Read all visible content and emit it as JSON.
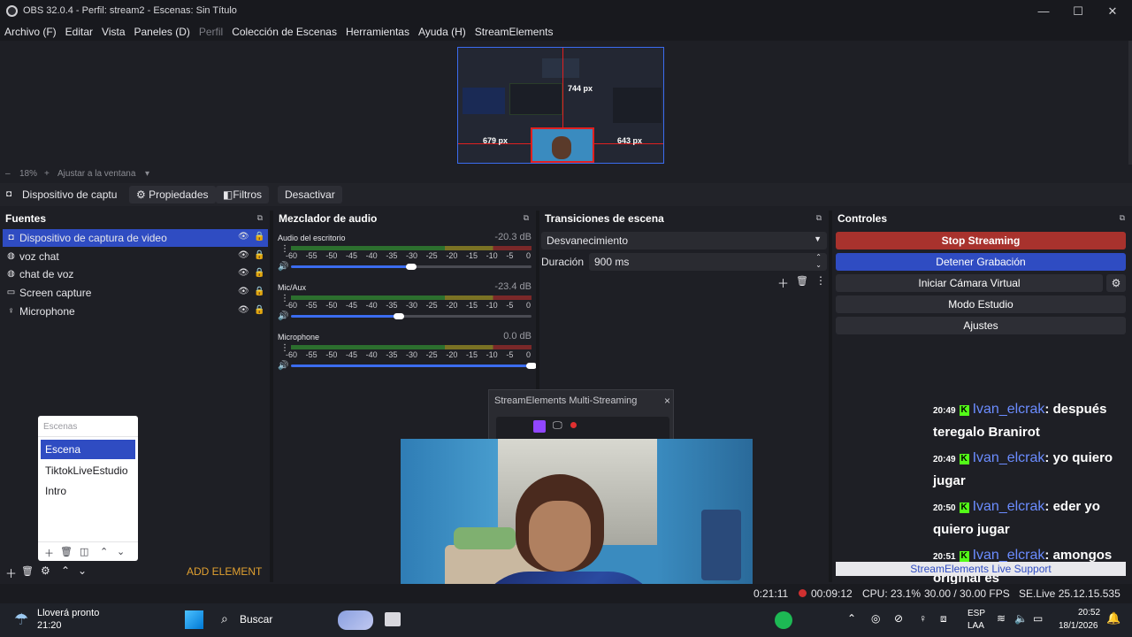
{
  "window": {
    "title": "OBS 32.0.4 - Perfil: stream2 - Escenas: Sin Título",
    "minimize": "—",
    "maximize": "☐",
    "close": "✕"
  },
  "menu": [
    {
      "label": "Archivo (F)",
      "dim": false
    },
    {
      "label": "Editar",
      "dim": false
    },
    {
      "label": "Vista",
      "dim": false
    },
    {
      "label": "Paneles (D)",
      "dim": false
    },
    {
      "label": "Perfil",
      "dim": true
    },
    {
      "label": "Colección de Escenas",
      "dim": false
    },
    {
      "label": "Herramientas",
      "dim": false
    },
    {
      "label": "Ayuda (H)",
      "dim": false
    },
    {
      "label": "StreamElements",
      "dim": false
    }
  ],
  "preview": {
    "top_px": "744 px",
    "left_px": "679 px",
    "right_px": "643 px",
    "zoom": "18%",
    "zoom_minus": "–",
    "zoom_plus": "+",
    "fit": "Ajustar a la ventana"
  },
  "source_toolbar": {
    "source_name": "Dispositivo de captu",
    "properties": "Propiedades",
    "filters": "Filtros",
    "deactivate": "Desactivar"
  },
  "docks": {
    "sources": "Fuentes",
    "mixer": "Mezclador de audio",
    "transitions": "Transiciones de escena",
    "controls": "Controles"
  },
  "sources": [
    {
      "label": "Dispositivo de captura de video",
      "icon": "camera-icon",
      "glyph": "◘",
      "selected": true
    },
    {
      "label": "voz chat",
      "icon": "browser-icon",
      "glyph": "◍",
      "selected": false
    },
    {
      "label": "chat de voz",
      "icon": "browser-icon",
      "glyph": "◍",
      "selected": false
    },
    {
      "label": "Screen capture",
      "icon": "monitor-icon",
      "glyph": "▭",
      "selected": false
    },
    {
      "label": "Microphone",
      "icon": "microphone-icon",
      "glyph": "♀",
      "selected": false
    }
  ],
  "scenes": {
    "header": "Escenas",
    "items": [
      {
        "label": "Escena",
        "selected": true
      },
      {
        "label": "TiktokLiveEstudio",
        "selected": false
      },
      {
        "label": "Intro",
        "selected": false
      }
    ]
  },
  "sources_footer": {
    "add_element": "ADD ELEMENT"
  },
  "mixer": {
    "ticks": [
      "-60",
      "-55",
      "-50",
      "-45",
      "-40",
      "-35",
      "-30",
      "-25",
      "-20",
      "-15",
      "-10",
      "-5",
      "0"
    ],
    "channels": [
      {
        "name": "Audio del escritorio",
        "db": "-20.3 dB",
        "volume": 0.5
      },
      {
        "name": "Mic/Aux",
        "db": "-23.4 dB",
        "volume": 0.45
      },
      {
        "name": "Microphone",
        "db": "0.0 dB",
        "volume": 1.0
      }
    ]
  },
  "transitions": {
    "selected": "Desvanecimiento",
    "duration_label": "Duración",
    "duration_value": "900 ms"
  },
  "controls": {
    "stop_streaming": "Stop Streaming",
    "stop_recording": "Detener Grabación",
    "virtual_camera": "Iniciar Cámara Virtual",
    "studio_mode": "Modo Estudio",
    "settings": "Ajustes",
    "stop_streaming_color": "#a8322d",
    "stop_recording_color": "#2f4cc2"
  },
  "se_popup": {
    "title": "StreamElements Multi-Streaming",
    "close": "×"
  },
  "chat": [
    {
      "time": "20:49",
      "user": "Ivan_elcrak",
      "message": ": después teregalo Branirot"
    },
    {
      "time": "20:49",
      "user": "Ivan_elcrak",
      "message": ": yo quiero jugar"
    },
    {
      "time": "20:50",
      "user": "Ivan_elcrak",
      "message": ": eder yo quiero jugar"
    },
    {
      "time": "20:51",
      "user": "Ivan_elcrak",
      "message": ": amongos original es"
    }
  ],
  "se_support": "StreamElements Live Support",
  "statusbar": {
    "stream_time": "0:21:11",
    "rec_time": "00:09:12",
    "cpu": "CPU: 23.1%",
    "fps": "30.00 / 30.00 FPS",
    "se_version": "SE.Live 25.12.15.535"
  },
  "taskbar": {
    "weather_title": "Lloverá pronto",
    "weather_time": "21:20",
    "search": "Buscar",
    "lang1": "ESP",
    "lang2": "LAA",
    "clock_time": "20:52",
    "clock_date": "18/1/2026"
  }
}
